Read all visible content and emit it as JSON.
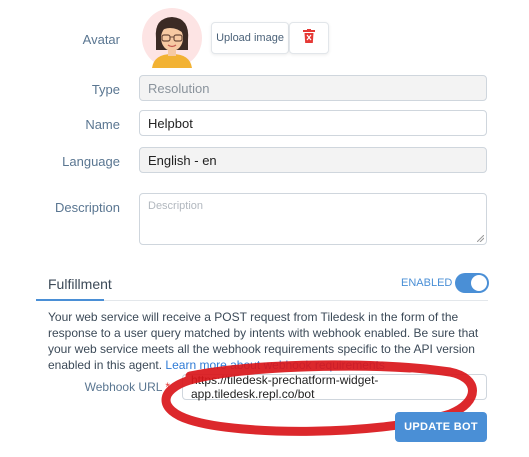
{
  "avatar": {
    "label": "Avatar",
    "upload_label": "Upload image"
  },
  "type": {
    "label": "Type",
    "value": "Resolution"
  },
  "name": {
    "label": "Name",
    "value": "Helpbot"
  },
  "language": {
    "label": "Language",
    "value": "English - en"
  },
  "description": {
    "label": "Description",
    "placeholder": "Description"
  },
  "fulfillment": {
    "tab_label": "Fulfillment",
    "status_label": "ENABLED",
    "enabled": true,
    "text": "Your web service will receive a POST request from Tiledesk in the form of the response to a user query matched by intents with webhook enabled. Be sure that your web service meets all the webhook requirements specific to the API version enabled in this agent. ",
    "link_text": "Learn more about webhook requirements"
  },
  "webhook": {
    "label": "Webhook URL",
    "required_mark": "*",
    "value": "https://tiledesk-prechatform-widget-app.tiledesk.repl.co/bot"
  },
  "update_button": "UPDATE BOT",
  "colors": {
    "accent": "#4a8fd6",
    "danger": "#e53935",
    "annotation": "#d9161a"
  }
}
